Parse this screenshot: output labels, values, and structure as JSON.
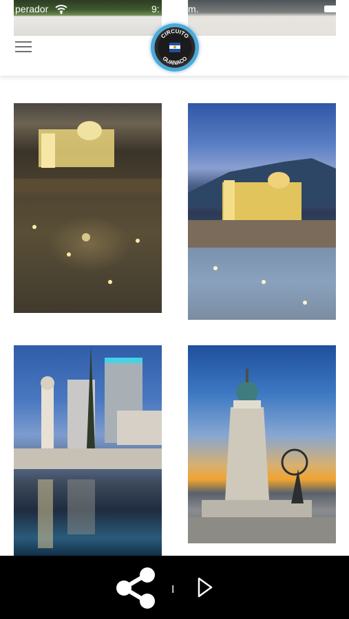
{
  "status_bar": {
    "carrier": "perador",
    "time": "9:",
    "time_suffix": "m.",
    "wifi_icon": "wifi-icon",
    "battery_icon": "battery-icon"
  },
  "header": {
    "menu_icon": "hamburger-menu-icon",
    "logo": {
      "icon": "circuito-guanaco-logo",
      "top_text": "CIRCUITO",
      "bottom_text": "GUANACO"
    }
  },
  "gallery": {
    "photos": [
      {
        "icon": "photo-plaza-night"
      },
      {
        "icon": "photo-plaza-dusk"
      },
      {
        "icon": "photo-monument-reflection"
      },
      {
        "icon": "photo-monument-sunset"
      }
    ]
  },
  "bottom_bar": {
    "share_icon": "share-icon",
    "divider": "I",
    "next_icon": "play-next-icon"
  },
  "colors": {
    "bottom_bar_bg": "#000000",
    "header_bg": "#ffffff",
    "logo_ring": "#4ea9d8"
  }
}
